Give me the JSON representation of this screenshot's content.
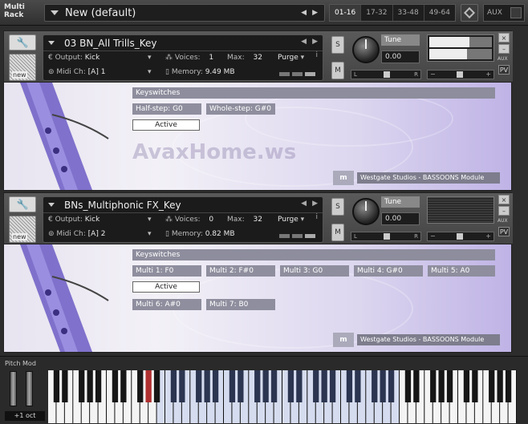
{
  "rack": {
    "label_line1": "Multi",
    "label_line2": "Rack",
    "name": "New (default)"
  },
  "pages": [
    "01-16",
    "17-32",
    "33-48",
    "49-64"
  ],
  "active_page": "01-16",
  "aux_label": "AUX",
  "watermark": "AvaxHome.ws",
  "instruments": [
    {
      "name": "03 BN_All Trills_Key",
      "output_label": "Output:",
      "output": "Kick",
      "voices_label": "Voices:",
      "voices": "1",
      "max_label": "Max:",
      "max": "32",
      "purge": "Purge",
      "midi_label": "Midi Ch:",
      "midi": "[A]  1",
      "memory_label": "Memory:",
      "memory": "9.49 MB",
      "tune_label": "Tune",
      "tune": "0.00",
      "keyswitches_label": "Keyswitches",
      "keyswitches": [
        "Half-step: G0",
        "Whole-step: G#0"
      ],
      "active_label": "Active",
      "studio": "Westgate Studios - BASSOONS Module"
    },
    {
      "name": "BNs_Multiphonic FX_Key",
      "output_label": "Output:",
      "output": "Kick",
      "voices_label": "Voices:",
      "voices": "0",
      "max_label": "Max:",
      "max": "32",
      "purge": "Purge",
      "midi_label": "Midi Ch:",
      "midi": "[A]  2",
      "memory_label": "Memory:",
      "memory": "0.82 MB",
      "tune_label": "Tune",
      "tune": "0.00",
      "keyswitches_label": "Keyswitches",
      "keyswitches": [
        "Multi 1: F0",
        "Multi 2: F#0",
        "Multi 3: G0",
        "Multi 4: G#0",
        "Multi 5: A0",
        "Multi 6: A#0",
        "Multi 7: B0"
      ],
      "active_label": "Active",
      "studio": "Westgate Studios - BASSOONS Module"
    }
  ],
  "common": {
    "new_label": "new",
    "solo": "S",
    "mute": "M",
    "pan_l": "L",
    "pan_r": "R",
    "aux_small": "AUX",
    "pv": "PV",
    "close": "×"
  },
  "keyboard": {
    "pitch_mod": "Pitch Mod",
    "octave": "+1 oct"
  },
  "colors": {
    "accent": "#b7a8e8",
    "keyswitch_chip": "#8e8e9e"
  }
}
